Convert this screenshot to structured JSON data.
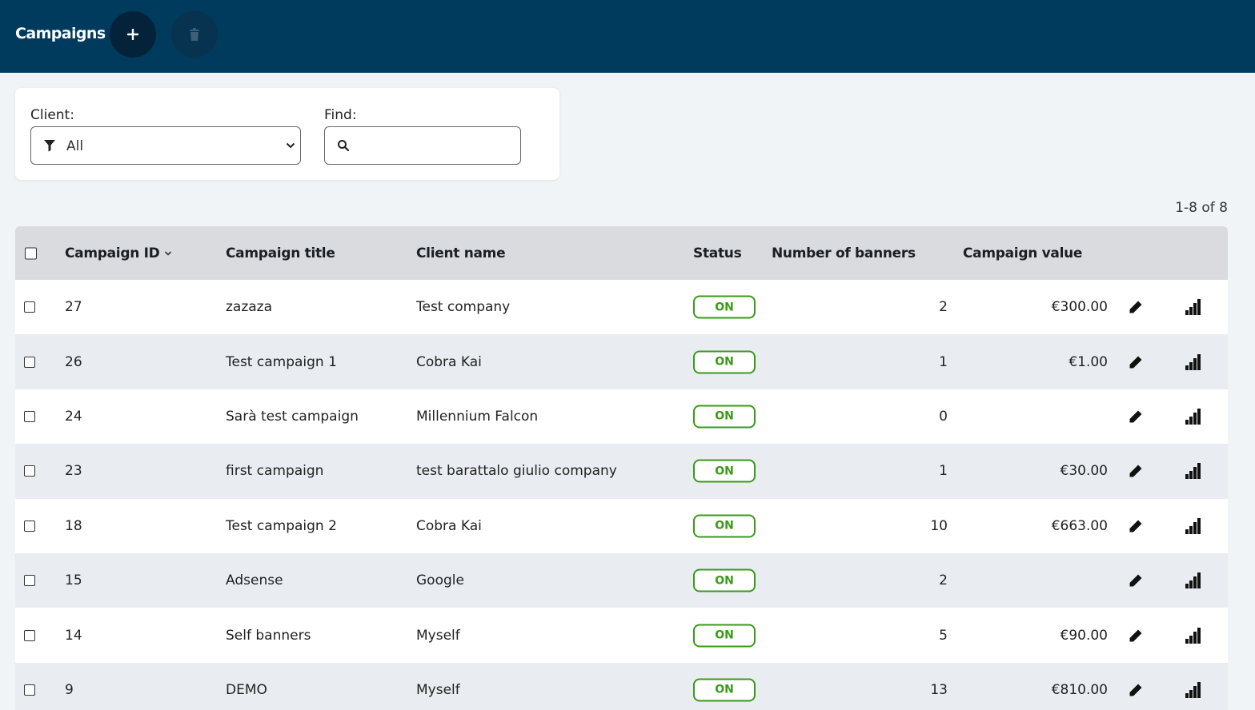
{
  "header": {
    "title": "Campaigns",
    "add_icon": "plus-icon",
    "delete_icon": "trash-icon",
    "bg_color": "#003a5c"
  },
  "filters": {
    "client_label": "Client:",
    "client_value": "All",
    "find_label": "Find:",
    "find_value": ""
  },
  "pagination": "1-8 of 8",
  "table": {
    "columns": {
      "id": "Campaign ID",
      "title": "Campaign title",
      "client": "Client name",
      "status": "Status",
      "banners": "Number of banners",
      "value": "Campaign value"
    },
    "rows": [
      {
        "id": "27",
        "title": "zazaza",
        "client": "Test company",
        "status": "ON",
        "banners": "2",
        "value": "€300.00"
      },
      {
        "id": "26",
        "title": "Test campaign 1",
        "client": "Cobra Kai",
        "status": "ON",
        "banners": "1",
        "value": "€1.00"
      },
      {
        "id": "24",
        "title": "Sarà test campaign",
        "client": "Millennium Falcon",
        "status": "ON",
        "banners": "0",
        "value": ""
      },
      {
        "id": "23",
        "title": "first campaign",
        "client": "test barattalo giulio company",
        "status": "ON",
        "banners": "1",
        "value": "€30.00"
      },
      {
        "id": "18",
        "title": "Test campaign 2",
        "client": "Cobra Kai",
        "status": "ON",
        "banners": "10",
        "value": "€663.00"
      },
      {
        "id": "15",
        "title": "Adsense",
        "client": "Google",
        "status": "ON",
        "banners": "2",
        "value": ""
      },
      {
        "id": "14",
        "title": "Self banners",
        "client": "Myself",
        "status": "ON",
        "banners": "5",
        "value": "€90.00"
      },
      {
        "id": "9",
        "title": "DEMO",
        "client": "Myself",
        "status": "ON",
        "banners": "13",
        "value": "€810.00"
      }
    ]
  },
  "colors": {
    "status_on": "#3a9a18",
    "row_alt": "#e9edf1",
    "header_row": "#d9dbde"
  }
}
